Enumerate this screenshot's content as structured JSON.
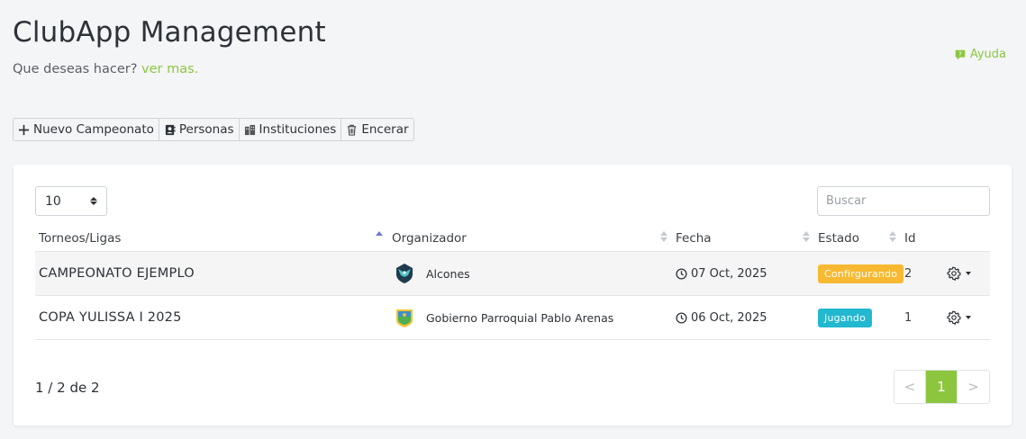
{
  "header": {
    "title": "ClubApp Management",
    "subtitle": "Que deseas hacer?",
    "subtitle_link": "ver mas.",
    "help_label": "Ayuda"
  },
  "toolbar": {
    "new_label": "Nuevo Campeonato",
    "people_label": "Personas",
    "institutions_label": "Instituciones",
    "reset_label": "Encerar"
  },
  "controls": {
    "page_size": "10",
    "search_placeholder": "Buscar"
  },
  "columns": {
    "name": "Torneos/Ligas",
    "organizer": "Organizador",
    "date": "Fecha",
    "status": "Estado",
    "id": "Id"
  },
  "rows": [
    {
      "name": "CAMPEONATO EJEMPLO",
      "organizer": "Alcones",
      "date": "07 Oct, 2025",
      "status": "Confirgurando",
      "status_color": "#f8b932",
      "id": "2"
    },
    {
      "name": "COPA YULISSA I 2025",
      "organizer": "Gobierno Parroquial Pablo Arenas",
      "date": "06 Oct, 2025",
      "status": "Jugando",
      "status_color": "#22b8cf",
      "id": "1"
    }
  ],
  "footer": {
    "info": "1 / 2 de 2",
    "prev": "<",
    "page": "1",
    "next": ">"
  },
  "colors": {
    "accent": "#8cc63f"
  }
}
